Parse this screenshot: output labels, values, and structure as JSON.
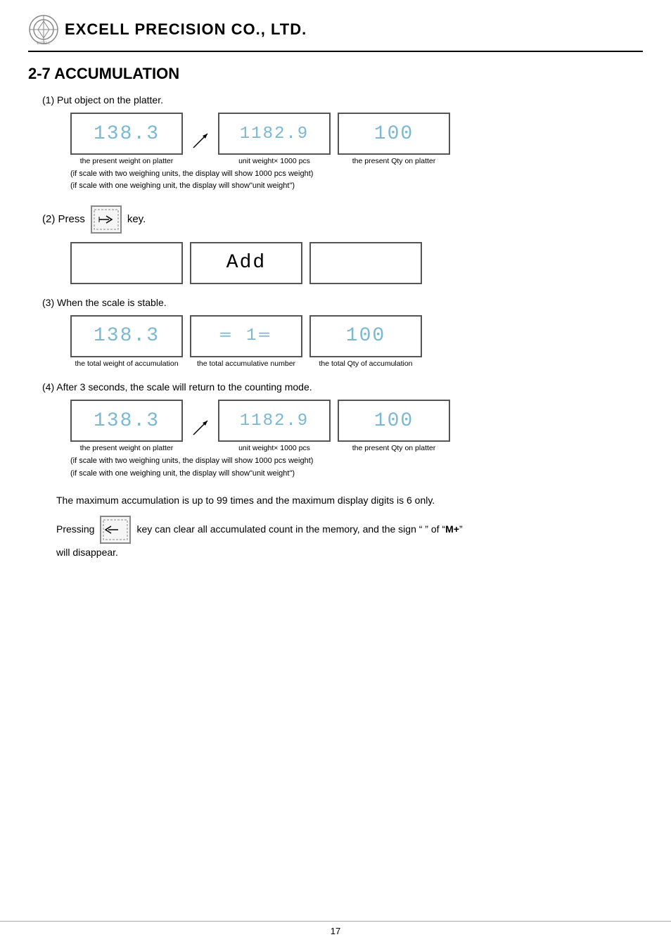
{
  "header": {
    "company": "EXCELL PRECISION CO., LTD."
  },
  "section": {
    "title": "2-7 ACCUMULATION"
  },
  "steps": [
    {
      "label": "(1) Put object on the platter.",
      "displays": [
        {
          "id": "d1",
          "content": "138.3",
          "type": "segment",
          "label": "the present weight on platter",
          "hasArrow": true
        },
        {
          "id": "d2",
          "content": "1182.9",
          "type": "segment",
          "label": "unit weight× 1000 pcs",
          "hasSlash": true
        },
        {
          "id": "d3",
          "content": "100",
          "type": "segment",
          "label": "the present Qty on platter"
        }
      ],
      "notes": [
        "(if scale with two weighing units, the display will show 1000 pcs weight)",
        "(if scale with one weighing unit, the display will show\"unit weight\")"
      ]
    }
  ],
  "step2": {
    "label": "(2) Press",
    "key_suffix": "key.",
    "displays": [
      {
        "id": "d4",
        "content": "",
        "type": "empty"
      },
      {
        "id": "d5",
        "content": "Add",
        "type": "add"
      },
      {
        "id": "d6",
        "content": "",
        "type": "empty"
      }
    ]
  },
  "step3": {
    "label": "(3) When the scale is stable.",
    "displays": [
      {
        "id": "d7",
        "content": "138.3",
        "type": "segment",
        "label": "the total weight of accumulation"
      },
      {
        "id": "d8",
        "content": "= 1=",
        "type": "dashes",
        "label": "the total accumulative number"
      },
      {
        "id": "d9",
        "content": "100",
        "type": "segment",
        "label": "the total Qty of accumulation"
      }
    ]
  },
  "step4": {
    "label": "(4) After 3 seconds, the scale will return to the counting mode.",
    "displays": [
      {
        "id": "d10",
        "content": "138.3",
        "type": "segment",
        "label": "the present weight on platter",
        "hasArrow": true
      },
      {
        "id": "d11",
        "content": "1182.9",
        "type": "segment",
        "label": "unit weight× 1000 pcs",
        "hasSlash": true
      },
      {
        "id": "d12",
        "content": "100",
        "type": "segment",
        "label": "the present Qty on platter"
      }
    ],
    "notes": [
      "(if scale with two weighing units, the display will show 1000 pcs weight)",
      "(if scale with one weighing unit, the display will show\"unit weight\")"
    ]
  },
  "max_note": "The maximum accumulation is up to 99 times and the maximum display digits is 6 only.",
  "pressing": {
    "prefix": "Pressing",
    "suffix": "key can clear all accumulated count in the memory, and the sign “  ” of “",
    "bold": "M+",
    "suffix2": "”"
  },
  "will_disappear": "will disappear.",
  "footer": {
    "page_number": "17"
  }
}
